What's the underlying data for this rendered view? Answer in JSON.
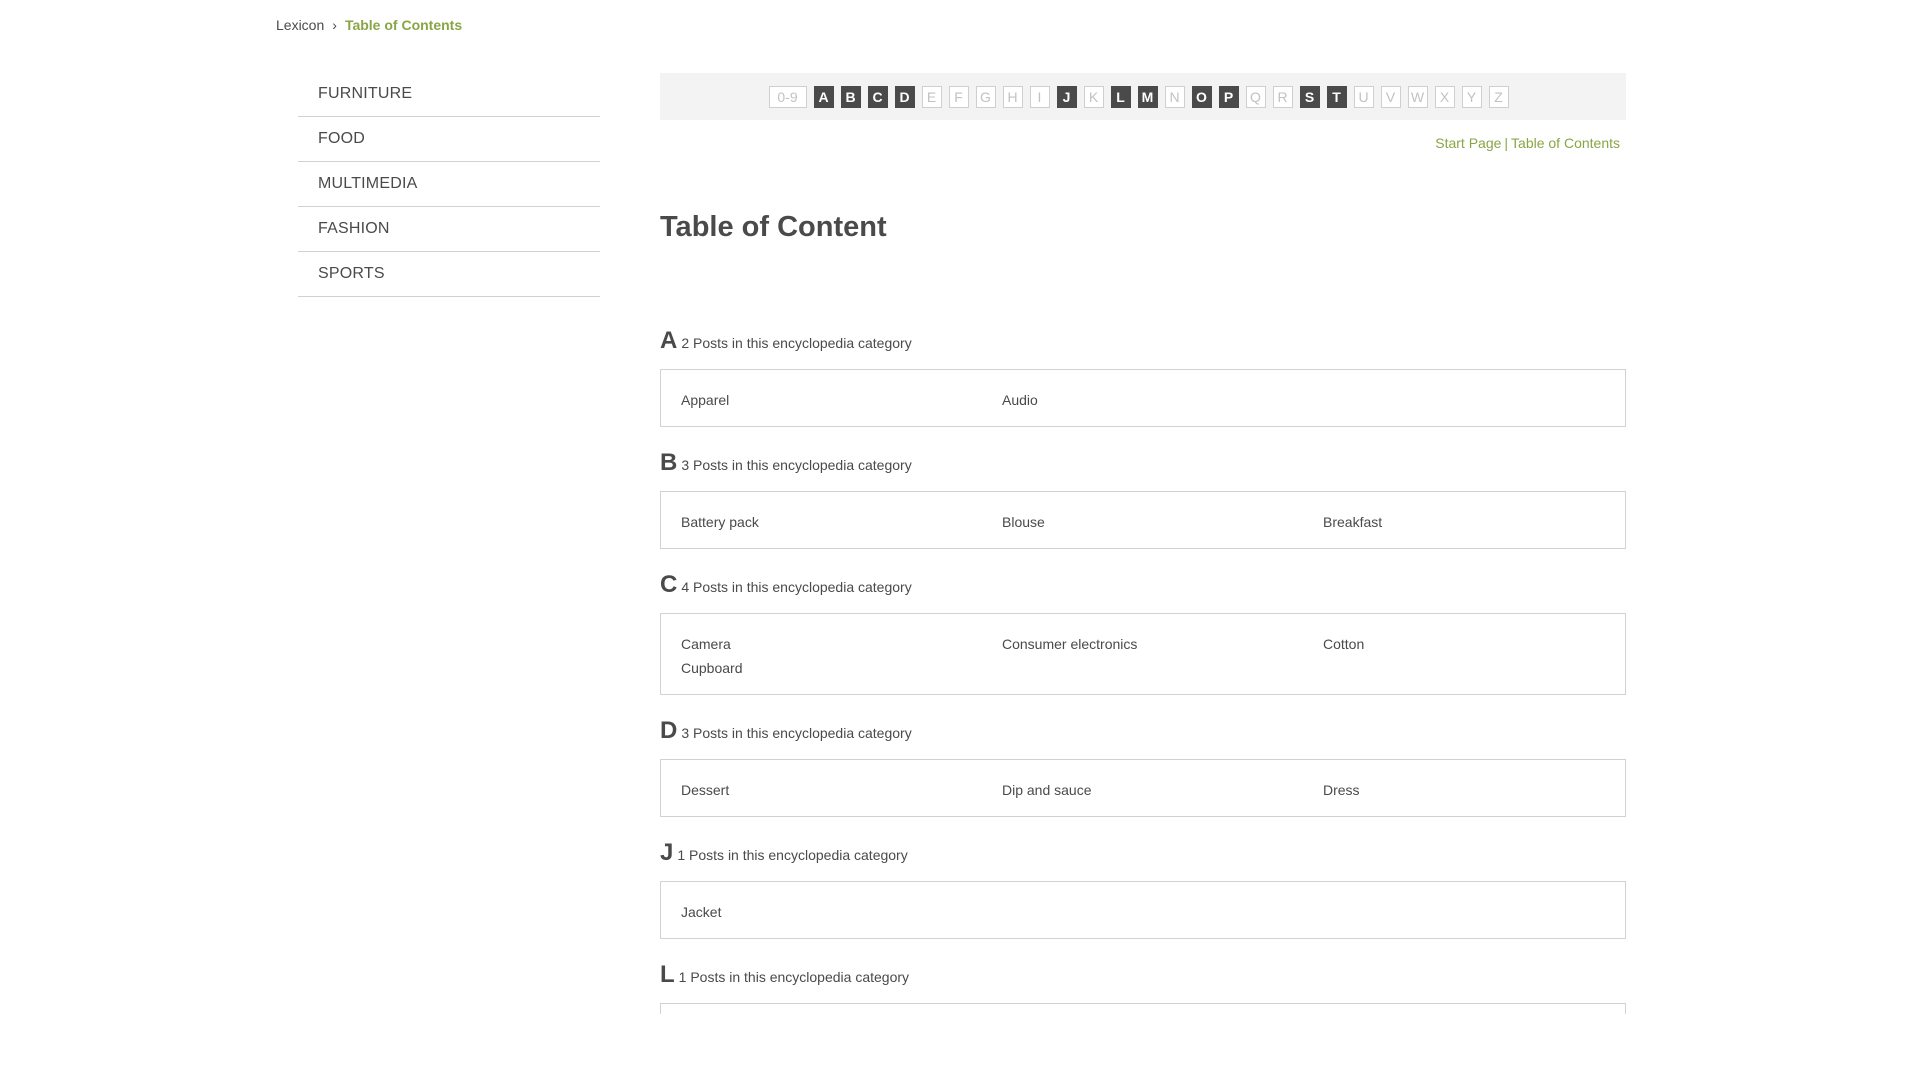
{
  "breadcrumb": {
    "parent": "Lexicon",
    "separator": "›",
    "current": "Table of Contents"
  },
  "sidebar": {
    "items": [
      {
        "label": "FURNITURE"
      },
      {
        "label": "FOOD"
      },
      {
        "label": "MULTIMEDIA"
      },
      {
        "label": "FASHION"
      },
      {
        "label": "SPORTS"
      }
    ]
  },
  "alphabet": [
    {
      "label": "0-9",
      "active": false
    },
    {
      "label": "A",
      "active": true
    },
    {
      "label": "B",
      "active": true
    },
    {
      "label": "C",
      "active": true
    },
    {
      "label": "D",
      "active": true
    },
    {
      "label": "E",
      "active": false
    },
    {
      "label": "F",
      "active": false
    },
    {
      "label": "G",
      "active": false
    },
    {
      "label": "H",
      "active": false
    },
    {
      "label": "I",
      "active": false
    },
    {
      "label": "J",
      "active": true
    },
    {
      "label": "K",
      "active": false
    },
    {
      "label": "L",
      "active": true
    },
    {
      "label": "M",
      "active": true
    },
    {
      "label": "N",
      "active": false
    },
    {
      "label": "O",
      "active": true
    },
    {
      "label": "P",
      "active": true
    },
    {
      "label": "Q",
      "active": false
    },
    {
      "label": "R",
      "active": false
    },
    {
      "label": "S",
      "active": true
    },
    {
      "label": "T",
      "active": true
    },
    {
      "label": "U",
      "active": false
    },
    {
      "label": "V",
      "active": false
    },
    {
      "label": "W",
      "active": false
    },
    {
      "label": "X",
      "active": false
    },
    {
      "label": "Y",
      "active": false
    },
    {
      "label": "Z",
      "active": false
    }
  ],
  "top_links": {
    "start_page": "Start Page",
    "separator": "|",
    "toc": "Table of Contents"
  },
  "page_title": "Table of Content",
  "sections": [
    {
      "letter": "A",
      "count": "2 Posts in this encyclopedia category",
      "entries": [
        "Apparel",
        "Audio"
      ]
    },
    {
      "letter": "B",
      "count": "3 Posts in this encyclopedia category",
      "entries": [
        "Battery pack",
        "Blouse",
        "Breakfast"
      ]
    },
    {
      "letter": "C",
      "count": "4 Posts in this encyclopedia category",
      "entries": [
        "Camera",
        "Consumer electronics",
        "Cotton",
        "Cupboard"
      ]
    },
    {
      "letter": "D",
      "count": "3 Posts in this encyclopedia category",
      "entries": [
        "Dessert",
        "Dip and sauce",
        "Dress"
      ]
    },
    {
      "letter": "J",
      "count": "1 Posts in this encyclopedia category",
      "entries": [
        "Jacket"
      ]
    },
    {
      "letter": "L",
      "count": "1 Posts in this encyclopedia category",
      "entries": []
    }
  ],
  "colors": {
    "accent": "#8aa545",
    "text": "#4a4a4a",
    "active_letter_bg": "#4a4a4a",
    "inactive_letter": "#c2c2c2",
    "border": "#d2d2d2"
  }
}
